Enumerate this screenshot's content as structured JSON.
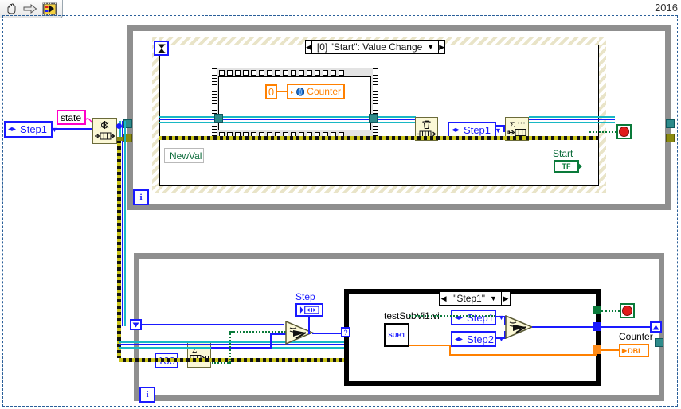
{
  "window": {
    "version_label": "2016",
    "toolbar": {
      "items": [
        {
          "name": "hand-tool-icon",
          "glyph": "✋"
        },
        {
          "name": "arrow-right-icon",
          "glyph": "➪"
        },
        {
          "name": "vi-icon",
          "glyph": "▦"
        }
      ]
    }
  },
  "left_controls": {
    "state_enum": {
      "value": "Step1",
      "left_glyph": "◂▸",
      "dropdown_glyph": "▼"
    },
    "state_label": "state"
  },
  "event_loop": {
    "iteration_label": "i",
    "event_case": {
      "label": "[0] \"Start\": Value Change",
      "left_arrow": "◀",
      "right_arrow": "▶",
      "dropdown_glyph": "▼"
    },
    "timeout_glyph": "⧗",
    "inner_loop": {
      "counter_constant": "0",
      "counter_control_label": "Counter",
      "counter_globe_glyph": "▸"
    },
    "newval_label": "NewVal",
    "step_enum": {
      "value": "Step1",
      "left_glyph": "◂▸",
      "dropdown_glyph": "▼"
    },
    "queue_node_label": "Σ...",
    "release_node_label": "",
    "start_label": "Start",
    "start_terminal": "TF",
    "stop_button_name": "stop-button"
  },
  "lower_loop": {
    "iteration_label": "i",
    "constant_100": "100",
    "queue_node_label": "Σ...",
    "step_indicator_label": "Step",
    "case_structure": {
      "label": "\"Step1\"",
      "left_arrow": "◀",
      "right_arrow": "▶",
      "dropdown_glyph": "▼"
    },
    "subvi_label": "testSubVi1.vi",
    "subvi_icon_text": "SUB1",
    "enum_step1": {
      "value": "Step1",
      "left_glyph": "◂▸",
      "dropdown_glyph": "▼"
    },
    "enum_step2": {
      "value": "Step2",
      "left_glyph": "◂▸",
      "dropdown_glyph": "▼"
    },
    "counter_label": "Counter",
    "counter_terminal": "DBL",
    "stop_button_name": "stop-button-lower"
  },
  "colors": {
    "wire_blue": "#1a1aff",
    "wire_green": "#00802b",
    "wire_orange": "#ff8000",
    "wire_cyan": "#18b8c4",
    "enum_blue": "#1a1aff",
    "pink_label": "#ff00c8",
    "loop_gray": "#8f8f8f",
    "node_yellow": "#fbf8d6",
    "stop_red": "#e01b1b"
  }
}
